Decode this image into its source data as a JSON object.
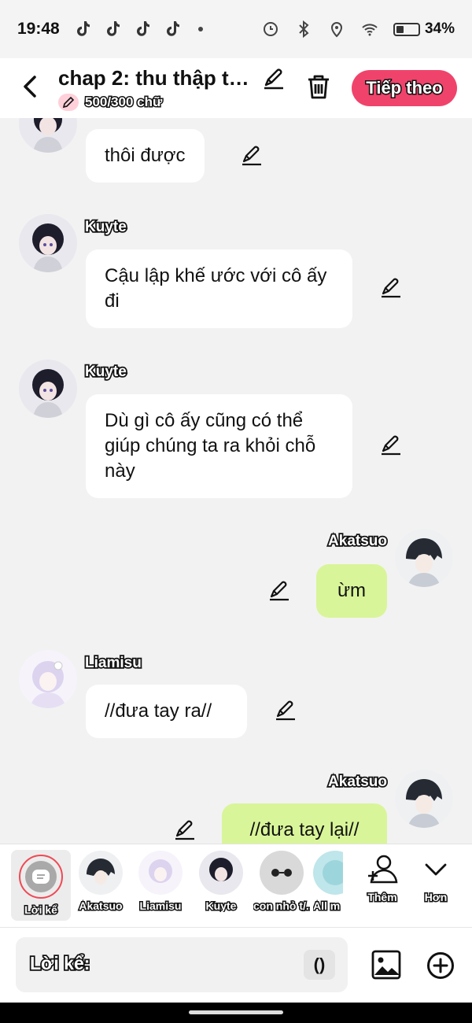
{
  "status_bar": {
    "time": "19:48",
    "battery": "34%",
    "battery_level": 0.34
  },
  "header": {
    "title": "chap 2: thu thập th...",
    "word_count": "500/300 chữ",
    "next_button": "Tiếp theo"
  },
  "messages": [
    {
      "sender": "",
      "side": "left",
      "text": "thôi được"
    },
    {
      "sender": "Kuyte",
      "side": "left",
      "text": "Cậu lập khế ước với cô ấy đi"
    },
    {
      "sender": "Kuyte",
      "side": "left",
      "text": "Dù gì cô ấy cũng có thể giúp chúng ta ra khỏi chỗ này"
    },
    {
      "sender": "Akatsuo",
      "side": "right",
      "text": "ừm"
    },
    {
      "sender": "Liamisu",
      "side": "left",
      "text": "//đưa tay ra//"
    },
    {
      "sender": "Akatsuo",
      "side": "right",
      "text": "//đưa tay lại//"
    }
  ],
  "characters": [
    {
      "label": "Lời kể",
      "selected": true
    },
    {
      "label": "Akatsuo"
    },
    {
      "label": "Liamisu"
    },
    {
      "label": "Kuyte"
    },
    {
      "label": "con nhỏ t/..."
    },
    {
      "label": "All m"
    }
  ],
  "tools": {
    "add": "Thêm",
    "more": "Hơn"
  },
  "input": {
    "label": "Lời kể:",
    "paren": "()"
  },
  "colors": {
    "accent": "#f0436b",
    "my_bubble": "#d9f599",
    "background": "#f2f2f2"
  },
  "icons": [
    "tiktok-icon",
    "alarm-icon",
    "bluetooth-icon",
    "location-icon",
    "wifi-icon",
    "battery-icon",
    "back-arrow-icon",
    "pencil-icon",
    "trash-icon",
    "add-person-icon",
    "chevron-down-icon",
    "image-icon",
    "plus-circle-icon"
  ]
}
